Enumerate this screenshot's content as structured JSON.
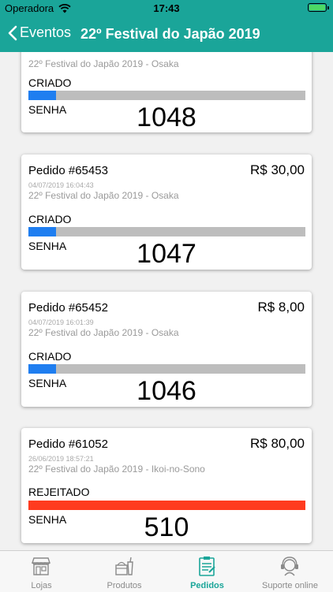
{
  "status_bar": {
    "carrier": "Operadora",
    "time": "17:43"
  },
  "nav": {
    "back_label": "Eventos",
    "title": "22º Festival do Japão 2019"
  },
  "orders": [
    {
      "order": "",
      "price": "",
      "date": "",
      "event": "22º Festival do Japão 2019 - Osaka",
      "status": "CRIADO",
      "status_progress": 0.1,
      "senha_label": "SENHA",
      "senha": "1048"
    },
    {
      "order": "Pedido #65453",
      "price": "R$  30,00",
      "date": "04/07/2019 16:04:43",
      "event": "22º Festival do Japão 2019 - Osaka",
      "status": "CRIADO",
      "status_progress": 0.1,
      "senha_label": "SENHA",
      "senha": "1047"
    },
    {
      "order": "Pedido #65452",
      "price": "R$  8,00",
      "date": "04/07/2019 16:01:39",
      "event": "22º Festival do Japão 2019 - Osaka",
      "status": "CRIADO",
      "status_progress": 0.1,
      "senha_label": "SENHA",
      "senha": "1046"
    },
    {
      "order": "Pedido #61052",
      "price": "R$  80,00",
      "date": "26/06/2019 18:57:21",
      "event": "22º Festival do Japão 2019 - Ikoi-no-Sono",
      "status": "REJEITADO",
      "status_progress": 1.0,
      "senha_label": "SENHA",
      "senha": "510"
    }
  ],
  "tabs": [
    {
      "label": "Lojas",
      "icon": "store-icon"
    },
    {
      "label": "Produtos",
      "icon": "products-icon"
    },
    {
      "label": "Pedidos",
      "icon": "orders-icon",
      "active": true
    },
    {
      "label": "Suporte online",
      "icon": "support-icon"
    }
  ],
  "colors": {
    "brand": "#1aa599",
    "progress": "#1f7ef0",
    "rejected": "#ff3b1f",
    "progress_track": "#bdbdbd"
  }
}
